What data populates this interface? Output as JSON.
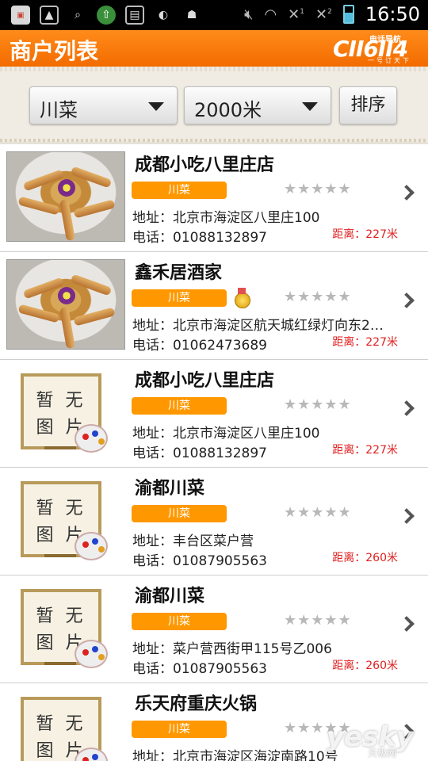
{
  "status_bar": {
    "time": "16:50",
    "sim1": "1",
    "sim2": "2",
    "icons": [
      "app-icon",
      "image-icon",
      "search-icon",
      "download-icon",
      "sd-card-icon",
      "watermelon-icon",
      "android-icon",
      "mute-icon",
      "wifi-icon",
      "signal-icon",
      "battery-icon"
    ]
  },
  "header": {
    "title": "商户列表",
    "logo_main": "CII6II4",
    "logo_sub": "电话导航",
    "logo_slogan": "一号订天下",
    "bg_color": "#f57c00"
  },
  "filters": {
    "category": "川菜",
    "distance": "2000米",
    "sort_label": "排序"
  },
  "list": {
    "items": [
      {
        "name": "成都小吃八里庄店",
        "tag": "川菜",
        "medal": false,
        "stars": "★★★★★",
        "address": "地址：北京市海淀区八里庄100",
        "phone": "电话：01088132897",
        "distance": "距离：227米",
        "image": "photo"
      },
      {
        "name": "鑫禾居酒家",
        "tag": "川菜",
        "medal": true,
        "stars": "★★★★★",
        "address": "地址：北京市海淀区航天城红绿灯向东2…",
        "phone": "电话：01062473689",
        "distance": "距离：227米",
        "image": "photo"
      },
      {
        "name": "成都小吃八里庄店",
        "tag": "川菜",
        "medal": false,
        "stars": "★★★★★",
        "address": "地址：北京市海淀区八里庄100",
        "phone": "电话：01088132897",
        "distance": "距离：227米",
        "image": "none"
      },
      {
        "name": "渝都川菜",
        "tag": "川菜",
        "medal": false,
        "stars": "★★★★★",
        "address": "地址：丰台区菜户营",
        "phone": "电话：01087905563",
        "distance": "距离：260米",
        "image": "none"
      },
      {
        "name": "渝都川菜",
        "tag": "川菜",
        "medal": false,
        "stars": "★★★★★",
        "address": "地址：菜户营西街甲115号乙006",
        "phone": "电话：01087905563",
        "distance": "距离：260米",
        "image": "none"
      },
      {
        "name": "乐天府重庆火锅",
        "tag": "川菜",
        "medal": false,
        "stars": "★★★★★",
        "address": "地址：北京市海淀区海淀南路10号",
        "phone": "",
        "distance": "",
        "image": "none"
      }
    ],
    "no_image_text_1": "暂 无",
    "no_image_text_2": "图 片"
  },
  "watermark": {
    "main": "yesky",
    "sub": "天极网"
  }
}
